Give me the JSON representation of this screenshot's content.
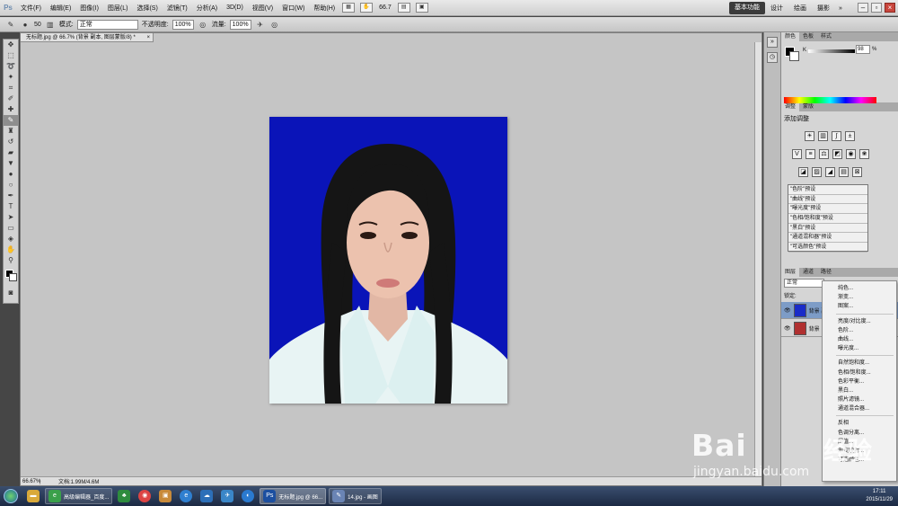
{
  "menubar": {
    "logo": "Ps",
    "items": [
      "文件(F)",
      "编辑(E)",
      "图像(I)",
      "图层(L)",
      "选择(S)",
      "滤镜(T)",
      "分析(A)",
      "3D(D)",
      "视图(V)",
      "窗口(W)",
      "帮助(H)"
    ],
    "zoom": "66.7"
  },
  "workspace": {
    "items": [
      "基本功能",
      "设计",
      "绘画",
      "摄影"
    ],
    "more": "»"
  },
  "options": {
    "brush_size": "50",
    "mode_label": "模式:",
    "mode_value": "正常",
    "opacity_label": "不透明度:",
    "opacity_value": "100%",
    "flow_label": "流量:",
    "flow_value": "100%"
  },
  "document": {
    "tab_title": "无标题.jpg @ 66.7% (背景 副本, 图层蒙版/8) *",
    "status_zoom": "66.67%",
    "status_doc": "文档:1.99M/4.6M"
  },
  "panels": {
    "color_tabs": [
      "颜色",
      "色板",
      "样式"
    ],
    "k_label": "K",
    "k_value": "98",
    "k_unit": "%",
    "adj_tabs": [
      "调整",
      "蒙版"
    ],
    "adj_title": "添加调整",
    "presets": [
      "\"色阶\"预设",
      "\"曲线\"预设",
      "\"曝光度\"预设",
      "\"色相/饱和度\"预设",
      "\"黑白\"预设",
      "\"通道混和器\"预设",
      "\"可选颜色\"预设"
    ],
    "layers_tabs": [
      "图层",
      "通道",
      "路径"
    ],
    "blend_mode": "正常",
    "lock_label": "锁定:",
    "layers": [
      {
        "name": "背景 副本",
        "thumb_color": "#1a2cc8"
      },
      {
        "name": "背景",
        "thumb_color": "#b03030"
      }
    ]
  },
  "context_menu": {
    "group1": [
      "纯色...",
      "渐变...",
      "图案..."
    ],
    "group2": [
      "亮度/对比度...",
      "色阶...",
      "曲线...",
      "曝光度..."
    ],
    "group3": [
      "自然饱和度...",
      "色相/饱和度...",
      "色彩平衡...",
      "黑白...",
      "照片滤镜...",
      "通道混合器..."
    ],
    "group4": [
      "反相",
      "色调分离...",
      "阈值...",
      "渐变映射...",
      "可选颜色..."
    ]
  },
  "taskbar": {
    "buttons": [
      {
        "label": "高级编辑器_百度...",
        "color": "#3aa04a"
      },
      {
        "label": "无标题.jpg @ 66...",
        "color": "#1c4fa0"
      },
      {
        "label": "14.jpg - 画图",
        "color": "#6a84b4"
      }
    ],
    "time": "17:11",
    "date": "2015/11/29"
  },
  "watermark": {
    "brand": "Bai",
    "brand2": "经验",
    "url": "jingyan.baidu.com"
  },
  "colors": {
    "photo_background": "#0a14b8",
    "selected_layer": "#7d9cc7"
  }
}
